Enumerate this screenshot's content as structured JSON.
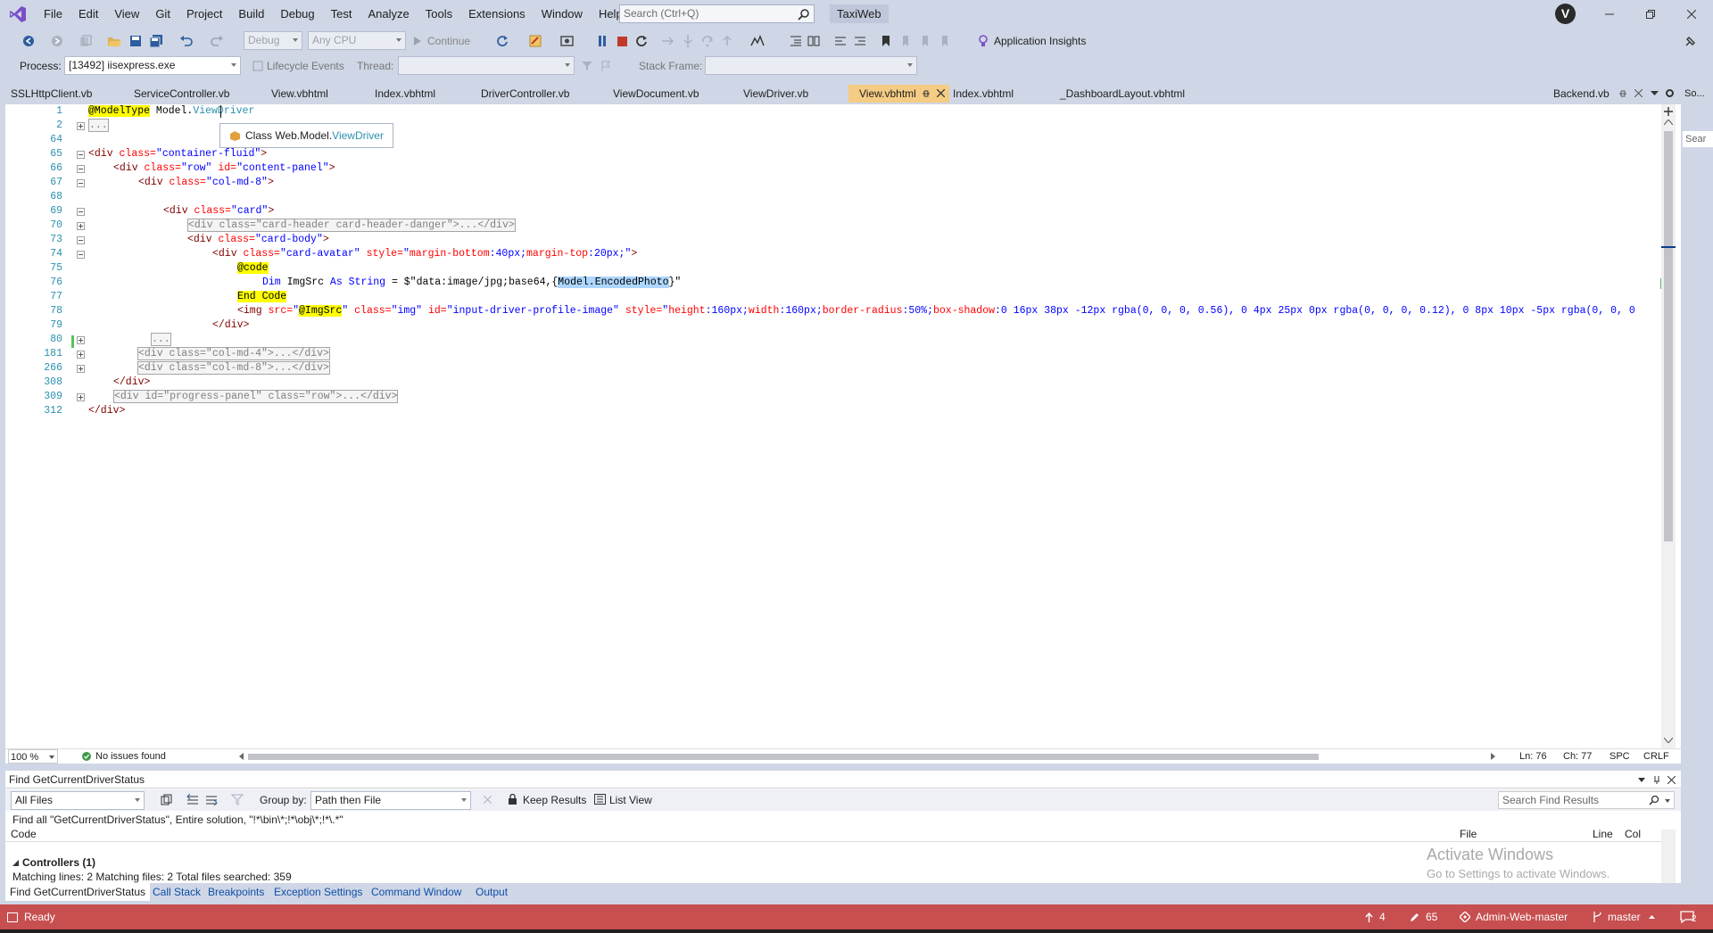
{
  "menu": [
    "File",
    "Edit",
    "View",
    "Git",
    "Project",
    "Build",
    "Debug",
    "Test",
    "Analyze",
    "Tools",
    "Extensions",
    "Window",
    "Help"
  ],
  "search": {
    "placeholder": "Search (Ctrl+Q)"
  },
  "solution_name": "TaxiWeb",
  "account_initial": "V",
  "toolbar": {
    "config": "Debug",
    "platform": "Any CPU",
    "continue_label": "Continue",
    "app_insights": "Application Insights"
  },
  "process_bar": {
    "process_label": "Process:",
    "process_value": "[13492] iisexpress.exe",
    "lifecycle_label": "Lifecycle Events",
    "thread_label": "Thread:",
    "stack_frame_label": "Stack Frame:"
  },
  "tabs": [
    "SSLHttpClient.vb",
    "ServiceController.vb",
    "View.vbhtml",
    "Index.vbhtml",
    "DriverController.vb",
    "ViewDocument.vb",
    "ViewDriver.vb",
    "View.vbhtml",
    "Index.vbhtml",
    "_DashboardLayout.vbhtml"
  ],
  "active_tab": "View.vbhtml",
  "pinned_tab": "Backend.vb",
  "side_tab": "So...",
  "side_search": "Sear",
  "line_numbers": [
    "1",
    "2",
    "64",
    "65",
    "66",
    "67",
    "68",
    "69",
    "70",
    "73",
    "74",
    "75",
    "76",
    "77",
    "78",
    "79",
    "80",
    "181",
    "266",
    "308",
    "309",
    "312"
  ],
  "code": {
    "l1_razor": "@ModelType",
    "l1_text": " Model.",
    "l1_type": "ViewDriver",
    "l2_collapsed": "...",
    "l65": [
      "<div ",
      "class=",
      "\"container-fluid\"",
      ">"
    ],
    "l66": [
      "<div ",
      "class=",
      "\"row\" ",
      "id=",
      "\"content-panel\"",
      ">"
    ],
    "l67": [
      "<div ",
      "class=",
      "\"col-md-8\"",
      ">"
    ],
    "l69": [
      "<div ",
      "class=",
      "\"card\"",
      ">"
    ],
    "l70_collapsed": "<div class=\"card-header card-header-danger\">...</div>",
    "l73": [
      "<div ",
      "class=",
      "\"card-body\"",
      ">"
    ],
    "l74": [
      "<div ",
      "class=",
      "\"card-avatar\" ",
      "style=",
      "\"",
      "margin-bottom",
      ":40px;",
      "margin-top",
      ":20px;\"",
      ">"
    ],
    "l75_razor": "@code",
    "l76_a": "Dim ",
    "l76_b": "ImgSrc ",
    "l76_c": "As ",
    "l76_d": "String",
    "l76_e": " = $\"data:image/jpg;base64,{",
    "l76_sel": "Model.EncodedPhoto",
    "l76_f": "}\"",
    "l77_razor": "End Code",
    "l78": [
      "<img ",
      "src=",
      "\"",
      "@ImgSrc",
      "\" ",
      "class=",
      "\"img\" ",
      "id=",
      "\"input-driver-profile-image\" ",
      "style=",
      "\"",
      "height",
      ":160px;",
      "width",
      ":160px;",
      "border-radius",
      ":50%;",
      "box-shadow",
      ":0 16px 38px -12px rgba(0, 0, 0, 0.56), 0 4px 25px 0px rgba(0, 0, 0, 0.12), 0 8px 10px -5px rgba(0, 0, 0"
    ],
    "l79": [
      "</div>"
    ],
    "l80_collapsed": "...",
    "l181_collapsed": "<div class=\"col-md-4\">...</div>",
    "l266_collapsed": "<div class=\"col-md-8\">...</div>",
    "l308": [
      "</div>"
    ],
    "l309_collapsed": "<div id=\"progress-panel\" class=\"row\">...</div>",
    "l312": [
      "</div>"
    ]
  },
  "quickinfo": {
    "prefix": "Class ",
    "ns": "Web.Model.",
    "type": "ViewDriver"
  },
  "editor_status": {
    "zoom": "100 %",
    "issues": "No issues found",
    "ln": "Ln: 76",
    "ch": "Ch: 77",
    "spc": "SPC",
    "crlf": "CRLF"
  },
  "find": {
    "title": "Find GetCurrentDriverStatus",
    "scope": "All Files",
    "group_label": "Group by:",
    "group_value": "Path then File",
    "keep_results": "Keep Results",
    "list_view": "List View",
    "search_placeholder": "Search Find Results",
    "query": "Find all \"GetCurrentDriverStatus\", Entire solution, \"!*\\bin\\*;!*\\obj\\*;!*\\.*\"",
    "col_code": "Code",
    "col_file": "File",
    "col_line": "Line",
    "col_col": "Col",
    "group_row": "Controllers (1)",
    "summary": "Matching lines: 2 Matching files: 2 Total files searched: 359",
    "watermark1": "Activate Windows",
    "watermark2": "Go to Settings to activate Windows."
  },
  "bottom_tabs": [
    "Find GetCurrentDriverStatus",
    "Call Stack",
    "Breakpoints",
    "Exception Settings",
    "Command Window",
    "Output"
  ],
  "status": {
    "ready": "Ready",
    "up": "4",
    "pencil": "65",
    "repo": "Admin-Web-master",
    "branch": "master",
    "notif": "2"
  },
  "colors": {
    "accent": "#c74f50",
    "active_tab": "#f5cc84",
    "chrome": "#cfd6e5"
  }
}
